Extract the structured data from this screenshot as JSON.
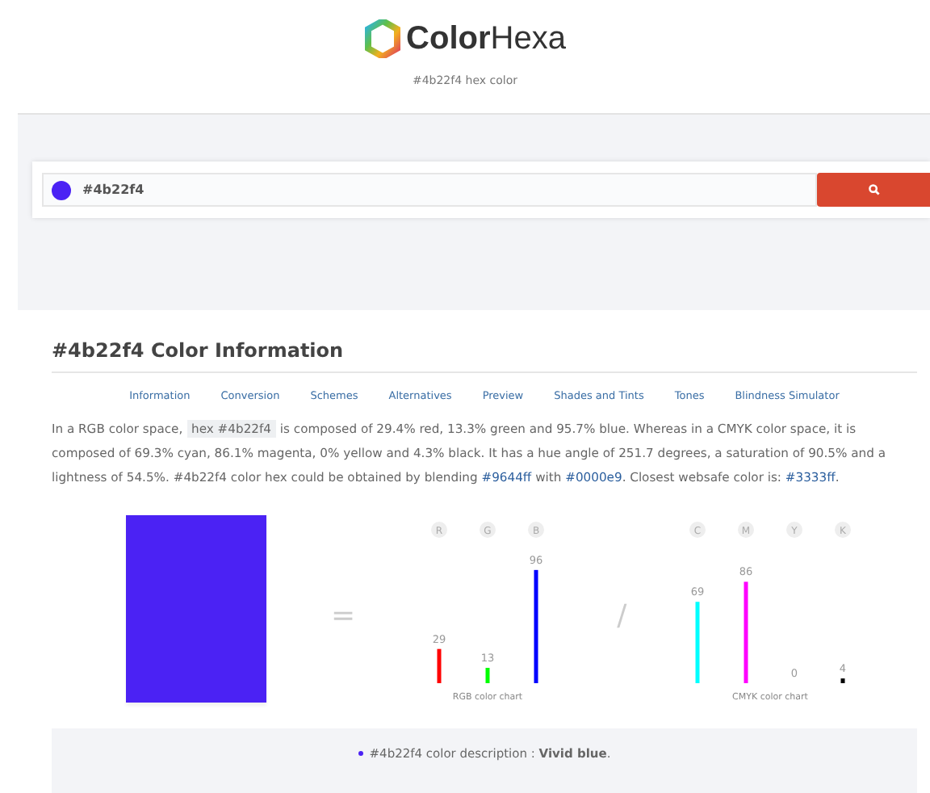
{
  "header": {
    "logo": "**Color**Hexa",
    "subtitle": "#4b22f4 hex color"
  },
  "search": {
    "value": "#4b22f4"
  },
  "info": {
    "title": "#4b22f4 Color Information",
    "nav": [
      "Information",
      "Conversion",
      "Schemes",
      "Alternatives",
      "Preview",
      "Shades and Tints",
      "Tones",
      "Blindness Simulator"
    ],
    "paragraph": [
      {
        "kind": "text",
        "text": "In a RGB color space, "
      },
      {
        "kind": "code",
        "text": "hex #4b22f4"
      },
      {
        "kind": "text",
        "text": " is composed of 29.4% red, 13.3% green and 95.7% blue. Whereas in a CMYK color space, it is composed of 69.3% cyan, 86.1% magenta, 0% yellow and 4.3% black. It has a hue angle of 251.7 degrees, a saturation of 90.5% and a lightness of 54.5%. #4b22f4 color hex could be obtained by blending "
      },
      {
        "kind": "link",
        "text": "#9644ff"
      },
      {
        "kind": "text",
        "text": " with "
      },
      {
        "kind": "link",
        "text": "#0000e9"
      },
      {
        "kind": "text",
        "text": ". Closest websafe color is: "
      },
      {
        "kind": "link",
        "text": "#3333ff"
      },
      {
        "kind": "text",
        "text": "."
      }
    ],
    "equals": "=",
    "slash": "/",
    "rgb_chart": {
      "chart_data": {
        "type": "bar",
        "title": "RGB color chart",
        "categories": [
          "R",
          "G",
          "B"
        ],
        "data_labels": true,
        "series": [
          {
            "color": "#ff0000",
            "values": [
              29,
              null,
              null
            ]
          },
          {
            "color": "#00ff00",
            "values": [
              null,
              13,
              null
            ]
          },
          {
            "color": "#0000ff",
            "values": [
              null,
              null,
              96
            ]
          }
        ]
      }
    },
    "cmyk_chart": {
      "chart_data": {
        "type": "bar",
        "title": "CMYK color chart",
        "categories": [
          "C",
          "M",
          "Y",
          "K"
        ],
        "data_labels": true,
        "series": [
          {
            "color": "#00ffff",
            "values": [
              69,
              null,
              null,
              null
            ]
          },
          {
            "color": "#ff00ff",
            "values": [
              null,
              86,
              null,
              null
            ]
          },
          {
            "values": [
              null,
              null,
              0,
              null
            ]
          },
          {
            "color": "#000000",
            "values": [
              null,
              null,
              null,
              4
            ]
          }
        ]
      }
    },
    "description": {
      "text": "#4b22f4 color description : **Vivid blue**."
    }
  }
}
